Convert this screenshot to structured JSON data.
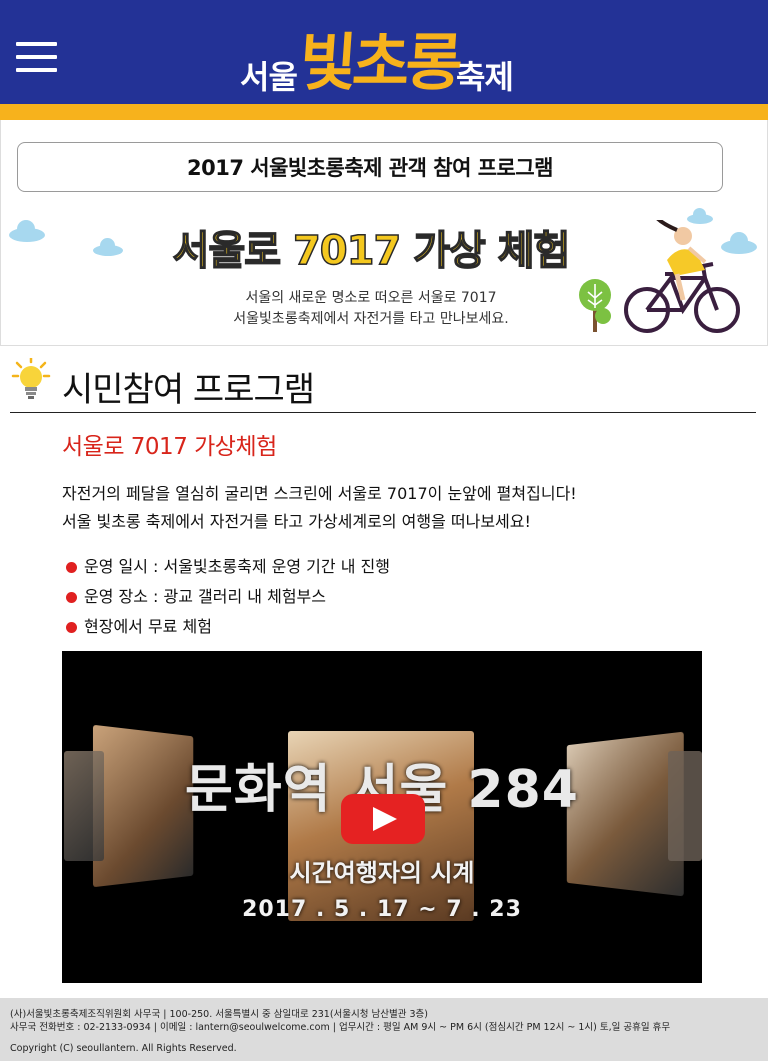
{
  "header": {
    "logo_small_left": "서울",
    "logo_big": "빛초롱",
    "logo_small_right": "축제"
  },
  "banner": {
    "box_title": "2017 서울빛초롱축제 관객 참여 프로그램",
    "headline": "서울로 7017 가상 체험",
    "desc_line1": "서울의 새로운 명소로 떠오른 서울로 7017",
    "desc_line2": "서울빛초롱축제에서 자전거를 타고 만나보세요."
  },
  "section": {
    "title": "시민참여 프로그램",
    "subhead": "서울로 7017 가상체험",
    "para_line1": "자전거의 페달을 열심히 굴리면 스크린에 서울로 7017이 눈앞에 펼쳐집니다!",
    "para_line2": "서울 빛초롱 축제에서 자전거를 타고 가상세계로의 여행을 떠나보세요!",
    "bullets": [
      "운영 일시 : 서울빛초롱축제 운영 기간 내 진행",
      "운영 장소 : 광교 갤러리 내 체험부스",
      "현장에서 무료 체험"
    ]
  },
  "video": {
    "title": "문화역 서울 284",
    "subtitle": "시간여행자의 시계",
    "date": "2017 . 5 . 17 ~ 7 . 23"
  },
  "footer": {
    "line1": "(사)서울빛초롱축제조직위원회 사무국 | 100-250. 서울특별시 중 삼일대로 231(서울시청 남산별관 3층)",
    "line2": "사무국 전화번호 : 02-2133-0934 | 이메일 : lantern@seoulwelcome.com | 업무시간 : 평일 AM 9시 ~ PM 6시 (점심시간 PM 12시 ~ 1시) 토,일 공휴일 휴무",
    "copyright": "Copyright (C) seoullantern. All Rights Reserved."
  },
  "colors": {
    "header_blue": "#233296",
    "accent_yellow": "#f7b21c",
    "subhead_red": "#d8251b",
    "bullet_red": "#e02020",
    "play_red": "#e52222"
  },
  "icons": [
    "hamburger-menu-icon",
    "lightbulb-icon",
    "bicycle-rider-icon",
    "tree-icon",
    "cloud-icon",
    "youtube-play-icon"
  ]
}
